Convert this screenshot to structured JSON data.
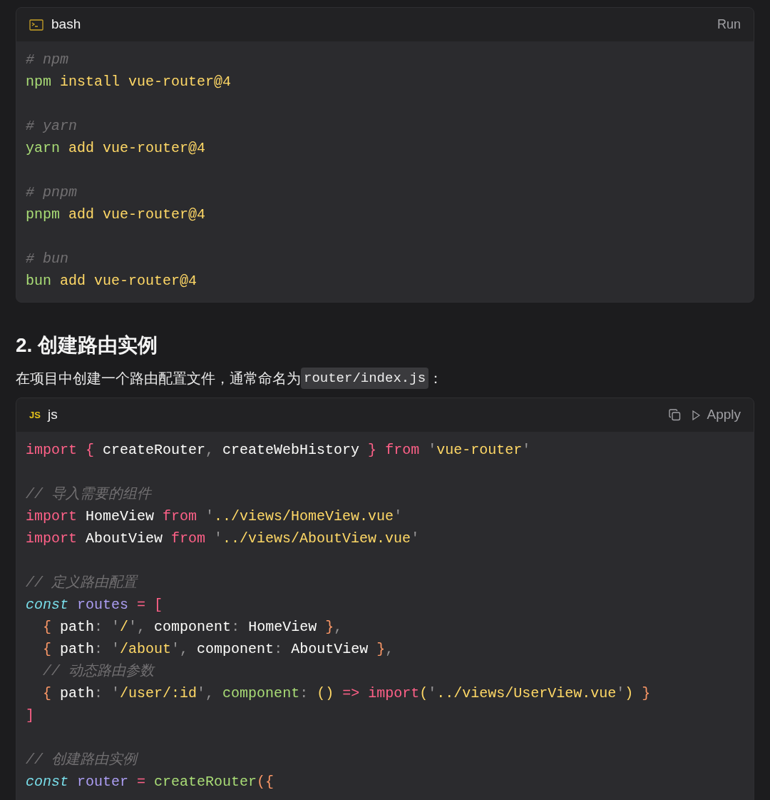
{
  "blocks_top": {
    "language": "bash",
    "action": "Run",
    "lines": [
      {
        "kind": "code",
        "tokens": [
          {
            "kind": "comment",
            "text": "# npm"
          }
        ]
      },
      {
        "kind": "code",
        "tokens": [
          {
            "kind": "cmd",
            "text": "npm"
          },
          {
            "kind": "arg",
            "text": " install vue-router@4"
          }
        ]
      },
      {
        "kind": "blank"
      },
      {
        "kind": "code",
        "tokens": [
          {
            "kind": "comment",
            "text": "# yarn"
          }
        ]
      },
      {
        "kind": "code",
        "tokens": [
          {
            "kind": "cmd",
            "text": "yarn"
          },
          {
            "kind": "arg",
            "text": " add vue-router@4"
          }
        ]
      },
      {
        "kind": "blank"
      },
      {
        "kind": "code",
        "tokens": [
          {
            "kind": "comment",
            "text": "# pnpm"
          }
        ]
      },
      {
        "kind": "code",
        "tokens": [
          {
            "kind": "cmd",
            "text": "pnpm"
          },
          {
            "kind": "arg",
            "text": " add vue-router@4"
          }
        ]
      },
      {
        "kind": "blank"
      },
      {
        "kind": "code",
        "tokens": [
          {
            "kind": "comment",
            "text": "# bun"
          }
        ]
      },
      {
        "kind": "code",
        "tokens": [
          {
            "kind": "cmd",
            "text": "bun"
          },
          {
            "kind": "arg",
            "text": " add vue-router@4"
          }
        ]
      }
    ]
  },
  "heading": "2. 创建路由实例",
  "paragraph": {
    "text": "在项目中创建一个路由配置文件，通常命名为",
    "code": "router/index.js",
    "suffix": "："
  },
  "block_bottom": {
    "badge": "JS",
    "language": "js",
    "action": "Apply",
    "lines": [
      {
        "kind": "code",
        "tokens": [
          {
            "kind": "kw",
            "text": "import {"
          },
          {
            "kind": "plain",
            "text": " createRouter"
          },
          {
            "kind": "punct",
            "text": ","
          },
          {
            "kind": "plain",
            "text": " createWebHistory "
          },
          {
            "kind": "kw",
            "text": "}"
          },
          {
            "kind": "kw",
            "text": " from"
          },
          {
            "kind": "punct",
            "text": " '"
          },
          {
            "kind": "str",
            "text": "vue-router"
          },
          {
            "kind": "punct",
            "text": "'"
          }
        ]
      },
      {
        "kind": "blank"
      },
      {
        "kind": "code",
        "tokens": [
          {
            "kind": "comment",
            "text": "// 导入需要的组件"
          }
        ]
      },
      {
        "kind": "code",
        "tokens": [
          {
            "kind": "kw",
            "text": "import"
          },
          {
            "kind": "plain",
            "text": " HomeView"
          },
          {
            "kind": "kw",
            "text": " from"
          },
          {
            "kind": "punct",
            "text": " '"
          },
          {
            "kind": "str",
            "text": "../views/HomeView.vue"
          },
          {
            "kind": "punct",
            "text": "'"
          }
        ]
      },
      {
        "kind": "code",
        "tokens": [
          {
            "kind": "kw",
            "text": "import"
          },
          {
            "kind": "plain",
            "text": " AboutView"
          },
          {
            "kind": "kw",
            "text": " from"
          },
          {
            "kind": "punct",
            "text": " '"
          },
          {
            "kind": "str",
            "text": "../views/AboutView.vue"
          },
          {
            "kind": "punct",
            "text": "'"
          }
        ]
      },
      {
        "kind": "blank"
      },
      {
        "kind": "code",
        "tokens": [
          {
            "kind": "comment",
            "text": "// 定义路由配置"
          }
        ]
      },
      {
        "kind": "code",
        "tokens": [
          {
            "kind": "storage",
            "text": "const"
          },
          {
            "kind": "var",
            "text": " routes"
          },
          {
            "kind": "kw",
            "text": " ="
          },
          {
            "kind": "kw",
            "text": " ["
          }
        ]
      },
      {
        "kind": "code",
        "tokens": [
          {
            "kind": "brace",
            "text": "  {"
          },
          {
            "kind": "plain",
            "text": " path"
          },
          {
            "kind": "punct",
            "text": ":"
          },
          {
            "kind": "punct",
            "text": " '"
          },
          {
            "kind": "str",
            "text": "/"
          },
          {
            "kind": "punct",
            "text": "',"
          },
          {
            "kind": "plain",
            "text": " component"
          },
          {
            "kind": "punct",
            "text": ":"
          },
          {
            "kind": "plain",
            "text": " HomeView "
          },
          {
            "kind": "brace",
            "text": "}"
          },
          {
            "kind": "punct",
            "text": ","
          }
        ]
      },
      {
        "kind": "code",
        "tokens": [
          {
            "kind": "brace",
            "text": "  {"
          },
          {
            "kind": "plain",
            "text": " path"
          },
          {
            "kind": "punct",
            "text": ":"
          },
          {
            "kind": "punct",
            "text": " '"
          },
          {
            "kind": "str",
            "text": "/about"
          },
          {
            "kind": "punct",
            "text": "',"
          },
          {
            "kind": "plain",
            "text": " component"
          },
          {
            "kind": "punct",
            "text": ":"
          },
          {
            "kind": "plain",
            "text": " AboutView "
          },
          {
            "kind": "brace",
            "text": "}"
          },
          {
            "kind": "punct",
            "text": ","
          }
        ]
      },
      {
        "kind": "code",
        "tokens": [
          {
            "kind": "comment",
            "text": "  // 动态路由参数"
          }
        ]
      },
      {
        "kind": "code",
        "tokens": [
          {
            "kind": "brace",
            "text": "  {"
          },
          {
            "kind": "plain",
            "text": " path"
          },
          {
            "kind": "punct",
            "text": ":"
          },
          {
            "kind": "punct",
            "text": " '"
          },
          {
            "kind": "str",
            "text": "/user/:id"
          },
          {
            "kind": "punct",
            "text": "',"
          },
          {
            "kind": "func",
            "text": " component"
          },
          {
            "kind": "punct",
            "text": ":"
          },
          {
            "kind": "str",
            "text": " ()"
          },
          {
            "kind": "kw",
            "text": " =>"
          },
          {
            "kind": "kw",
            "text": " import"
          },
          {
            "kind": "str",
            "text": "("
          },
          {
            "kind": "punct",
            "text": "'"
          },
          {
            "kind": "str",
            "text": "../views/UserView.vue"
          },
          {
            "kind": "punct",
            "text": "'"
          },
          {
            "kind": "str",
            "text": ")"
          },
          {
            "kind": "brace",
            "text": " }"
          }
        ]
      },
      {
        "kind": "code",
        "tokens": [
          {
            "kind": "kw",
            "text": "]"
          }
        ]
      },
      {
        "kind": "blank"
      },
      {
        "kind": "code",
        "tokens": [
          {
            "kind": "comment",
            "text": "// 创建路由实例"
          }
        ]
      },
      {
        "kind": "code",
        "tokens": [
          {
            "kind": "storage",
            "text": "const"
          },
          {
            "kind": "var",
            "text": " router"
          },
          {
            "kind": "kw",
            "text": " ="
          },
          {
            "kind": "func",
            "text": " createRouter"
          },
          {
            "kind": "brace",
            "text": "({"
          }
        ]
      }
    ]
  }
}
